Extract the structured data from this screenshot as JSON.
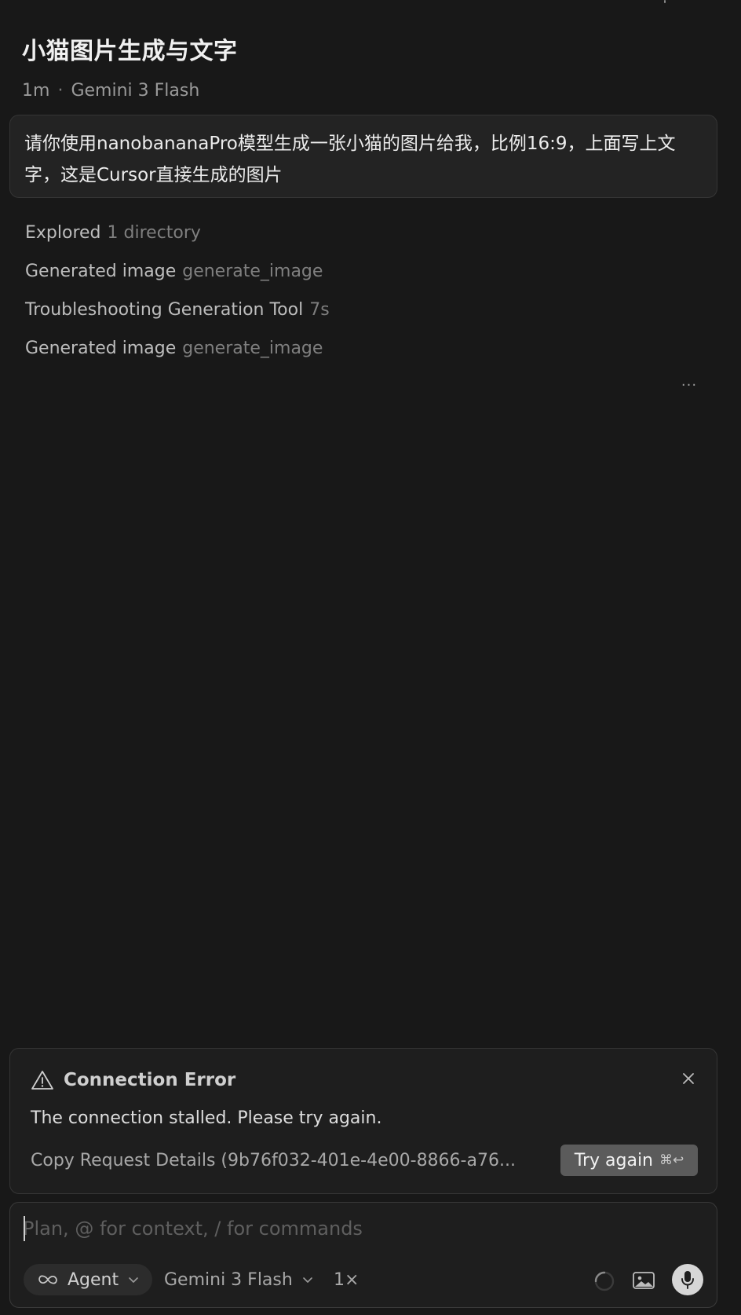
{
  "conversation": {
    "title": "小猫图片生成与文字",
    "elapsed": "1m",
    "separator": "·",
    "model": "Gemini 3 Flash"
  },
  "user_message": {
    "text": "请你使用nanobananaPro模型生成一张小猫的图片给我，比例16:9，上面写上文字，这是Cursor直接生成的图片"
  },
  "steps": [
    {
      "title": "Explored",
      "detail": "1 directory"
    },
    {
      "title": "Generated image",
      "detail": "generate_image"
    },
    {
      "title": "Troubleshooting Generation Tool",
      "detail": "7s"
    },
    {
      "title": "Generated image",
      "detail": "generate_image"
    }
  ],
  "more_menu": {
    "label": "···"
  },
  "error": {
    "title": "Connection Error",
    "message": "The connection stalled. Please try again.",
    "copy_details": "Copy Request Details (9b76f032-401e-4e00-8866-a76...",
    "try_again_label": "Try again",
    "try_again_shortcut": "⌘↩",
    "icons": {
      "warning": "warning-triangle-icon",
      "close": "close-icon"
    }
  },
  "composer": {
    "placeholder": "Plan, @ for context, / for commands",
    "value": "",
    "mode_label": "Agent",
    "model_label": "Gemini 3 Flash",
    "multiplier": "1×",
    "icons": {
      "mode": "infinity-icon",
      "status": "loading-spinner-icon",
      "attach": "image-icon",
      "voice": "microphone-icon"
    }
  },
  "colors": {
    "background": "#181818",
    "card": "#1e1e1e",
    "user_bubble": "#232323",
    "border": "#353535",
    "try_again_bg": "#5b5b5b",
    "mic_bg": "#d6d6d6",
    "muted_text": "#7f7f7f"
  }
}
